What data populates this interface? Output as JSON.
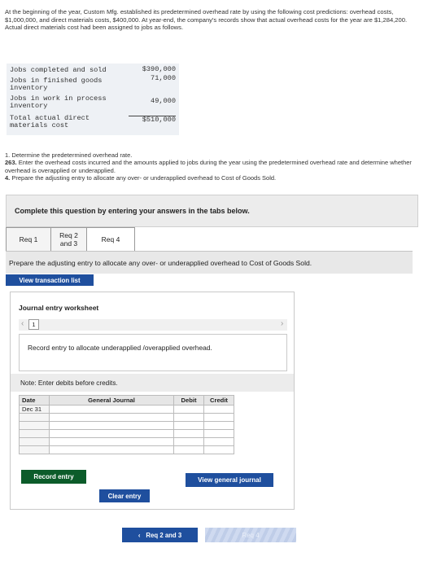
{
  "intro_text": "At the beginning of the year, Custom Mfg. established its predetermined overhead rate by using the following cost predictions: overhead costs, $1,000,000, and direct materials costs, $400,000. At year-end, the company's records show that actual overhead costs for the year are $1,284,200. Actual direct materials cost had been assigned to jobs as follows.",
  "cost_table": {
    "rows": [
      {
        "label": "Jobs completed and sold",
        "amount": "$390,000"
      },
      {
        "label": "Jobs in finished goods inventory",
        "amount": "71,000"
      },
      {
        "label": "Jobs in work in process inventory",
        "amount": "49,000"
      },
      {
        "label": "Total actual direct materials cost",
        "amount": "$510,000"
      }
    ]
  },
  "questions": {
    "q1": "1. Determine the predetermined overhead rate.",
    "q263_num": "263.",
    "q263_text": " Enter the overhead costs incurred and the amounts applied to jobs during the year using the predetermined overhead rate and determine whether overhead is overapplied or underapplied.",
    "q4_num": "4.",
    "q4_text": " Prepare the adjusting entry to allocate any over- or underapplied overhead to Cost of Goods Sold."
  },
  "instruction": "Complete this question by entering your answers in the tabs below.",
  "tabs": [
    {
      "label": "Req 1"
    },
    {
      "label": "Req 2 and 3"
    },
    {
      "label": "Req 4"
    }
  ],
  "tab_prompt": "Prepare the adjusting entry to allocate any over- or underapplied overhead to Cost of Goods Sold.",
  "view_transaction_list": "View transaction list",
  "worksheet": {
    "title": "Journal entry worksheet",
    "page_number": "1",
    "record_prompt": "Record entry to allocate underapplied /overapplied overhead.",
    "note": "Note: Enter debits before credits.",
    "columns": {
      "date": "Date",
      "account": "General Journal",
      "debit": "Debit",
      "credit": "Credit"
    },
    "rows": [
      {
        "date": "Dec 31",
        "account": "",
        "debit": "",
        "credit": ""
      },
      {
        "date": "",
        "account": "",
        "debit": "",
        "credit": ""
      },
      {
        "date": "",
        "account": "",
        "debit": "",
        "credit": ""
      },
      {
        "date": "",
        "account": "",
        "debit": "",
        "credit": ""
      },
      {
        "date": "",
        "account": "",
        "debit": "",
        "credit": ""
      },
      {
        "date": "",
        "account": "",
        "debit": "",
        "credit": ""
      }
    ],
    "record_button": "Record entry",
    "clear_button": "Clear entry",
    "view_journal_button": "View general journal"
  },
  "nav": {
    "prev_label": "Req 2 and 3",
    "next_label": "Req 4"
  },
  "colors": {
    "primary_button": "#1f4f9e",
    "record_button": "#0c5c2a"
  }
}
